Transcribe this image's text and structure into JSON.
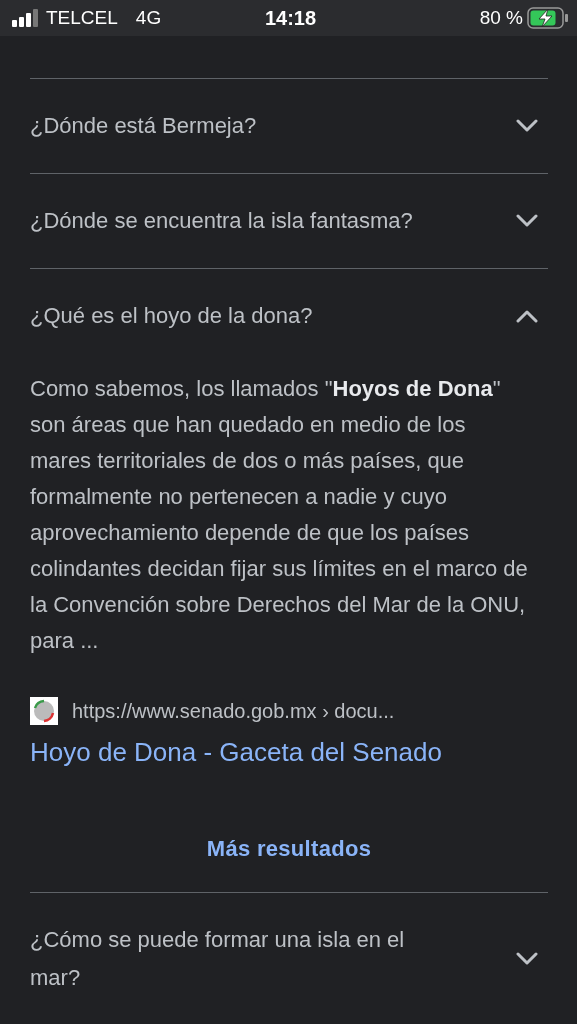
{
  "status_bar": {
    "carrier": "TELCEL",
    "network": "4G",
    "time": "14:18",
    "battery": "80 %",
    "charging": true
  },
  "questions": [
    {
      "question": "¿Dónde está Bermeja?",
      "expanded": false
    },
    {
      "question": "¿Dónde se encuentra la isla fantasma?",
      "expanded": false
    },
    {
      "question": "¿Qué es el hoyo de la dona?",
      "expanded": true,
      "answer": {
        "text": "Como sabemos, los llamados \"**Hoyos de Dona**\" son áreas que han quedado en medio de los mares territoriales de dos o más países, que formalmente no pertenecen a nadie y cuyo aprovechamiento depende de que los países colindantes decidan fijar sus límites en el marco de la Convención sobre Derechos del Mar de la ONU, para ...",
        "source": "https://www.senado.gob.mx › docu...",
        "link": "Hoyo de Dona - Gaceta del Senado",
        "more": "Más resultados"
      }
    },
    {
      "question": "¿Cómo se puede formar una isla en el mar?",
      "expanded": false
    }
  ]
}
